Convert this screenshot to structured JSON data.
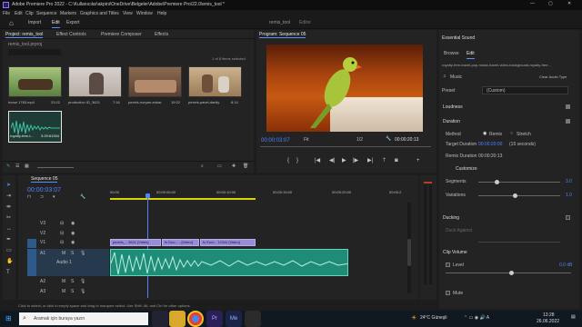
{
  "window": {
    "title": "Adobe Premiere Pro 2022 - C:\\Kullanıcılar\\akpini\\OneDrive\\Belgeler\\Adobe\\Premiere Pro\\22.0\\emis_tool *",
    "controls": [
      "—",
      "▢",
      "✕"
    ]
  },
  "menu": [
    "File",
    "Edit",
    "Clip",
    "Sequence",
    "Markers",
    "Graphics and Titles",
    "View",
    "Window",
    "Help"
  ],
  "workspace": {
    "home": "⌂",
    "tabs": [
      "Import",
      "Edit",
      "Export"
    ],
    "active_tab": "Edit",
    "center_tabs": [
      "remis_tool",
      "Editor"
    ]
  },
  "project_panel": {
    "tabs": [
      "Project: remis_tool",
      "Effect Controls",
      "Premiere Composer",
      "Effects"
    ],
    "path": "remis_tool.prproj",
    "selection": "1 of 8 items selected",
    "items": [
      {
        "name": "horse 1783.mp4",
        "duration": "23:22",
        "color": "#7aa05a"
      },
      {
        "name": "production ID_3621",
        "duration": "7:16",
        "color": "#c9c2bb"
      },
      {
        "name": "pexels-noryan-eduar",
        "duration": "19:22",
        "color": "#8a6a50"
      },
      {
        "name": "pexels-pavel-danily",
        "duration": "8:14",
        "color": "#b89a72"
      },
      {
        "name": "royalty-free-t...",
        "duration": "3:29:61904",
        "color": "#1e3b35"
      }
    ]
  },
  "program_monitor": {
    "title": "Program: Sequence 05",
    "timecode": "00:00:03:07",
    "fit": "Fit",
    "ratio": "1/2",
    "duration": "00:00:20:13"
  },
  "essential_sound": {
    "panel_title": "Essential Sound",
    "tabs": [
      "Browse",
      "Edit"
    ],
    "clip_name": "royalty-free-travel-pop-music-travel-video-background-royalty-free...",
    "type_label": "Music",
    "clear_label": "Clear Audio Type",
    "preset_label": "Preset",
    "preset_value": "(Custom)",
    "sections": {
      "loudness": "Loudness",
      "duration": "Duration",
      "method_label": "Method",
      "method_remix": "Remix",
      "method_stretch": "Stretch",
      "target_label": "Target Duration",
      "target_value": "00:00:20:00",
      "target_hint": "(15 seconds)",
      "remix_duration_label": "Remix Duration",
      "remix_duration_value": "00:00:20:13",
      "customize": "Customize",
      "segments_label": "Segments",
      "segments_value": "3.0",
      "variations_label": "Variations",
      "variations_value": "1.0",
      "ducking": "Ducking",
      "duck_against": "Duck Against",
      "clip_volume": "Clip Volume",
      "level_label": "Level",
      "level_value": "0.0 dB",
      "mute_label": "Mute"
    }
  },
  "timeline": {
    "sequence_tab": "Sequence 05",
    "timecode": "00:00:03:07",
    "ruler": [
      "00:00",
      "00:00:05:00",
      "00:00:10:00",
      "00:00:15:00",
      "00:00:20:00",
      "00:00:2"
    ],
    "tracks": [
      "V3",
      "V2",
      "V1",
      "A1",
      "A2",
      "A3"
    ],
    "audio_label": "Audio 1",
    "clips": [
      {
        "label": "pexels_...3621 [Video]",
        "track": "V1"
      },
      {
        "label": "fx  Duo - ...[Video]",
        "track": "V1"
      },
      {
        "label": "fx  Euro - 12344 [Video]",
        "track": "V1"
      }
    ],
    "status_hint": "Click to select, or click in empty space and drag to marquee select. Use Shift, Alt, and Ctrl for other options."
  },
  "taskbar": {
    "search_placeholder": "Aramak için buraya yazın",
    "weather": "24°C Güneşli",
    "time": "13:28",
    "date": "26.06.2022"
  },
  "colors": {
    "accent": "#5b8ff9",
    "timecode": "#4f83ff",
    "clip_video": "#9a8bd6",
    "clip_audio": "#2aa38e",
    "work_area": "#d7d700"
  }
}
